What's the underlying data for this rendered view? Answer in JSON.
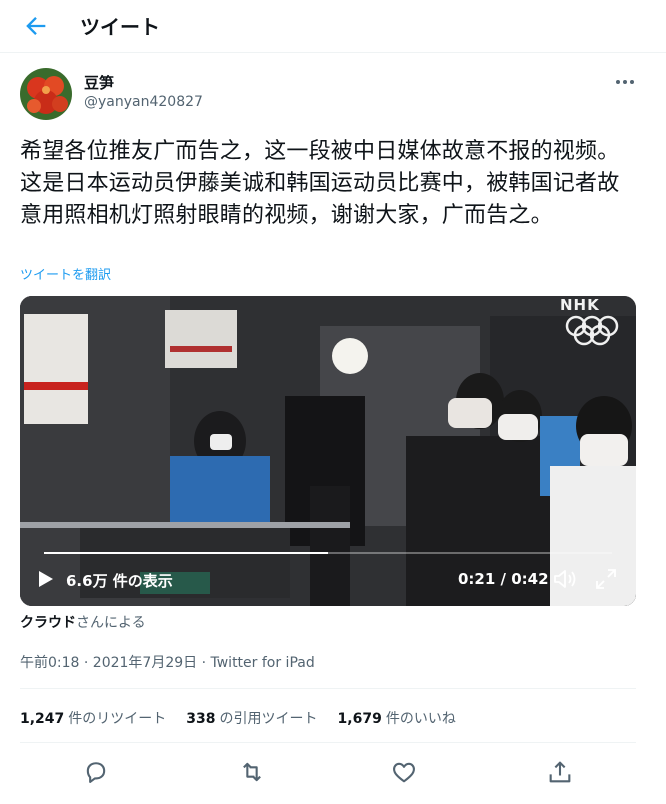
{
  "header": {
    "title": "ツイート"
  },
  "author": {
    "display_name": "豆笋",
    "handle": "@yanyan420827"
  },
  "tweet": {
    "text": "希望各位推友广而告之，这一段被中日媒体故意不报的视频。这是日本运动员伊藤美诚和韩国运动员比赛中，被韩国记者故意用照相机灯照射眼睛的视频，谢谢大家，广而告之。",
    "translate_label": "ツイートを翻訳"
  },
  "video": {
    "views_label": "6.6万 件の表示",
    "time_label": "0:21 / 0:42",
    "progress": 0.5,
    "watermark": "NHK"
  },
  "credit": {
    "name": "クラウド",
    "suffix": "さんによる"
  },
  "meta": {
    "timestamp": "午前0:18 · 2021年7月29日 · Twitter for iPad"
  },
  "stats": {
    "retweets_count": "1,247",
    "retweets_label": "件のリツイート",
    "quotes_count": "338",
    "quotes_label": "の引用ツイート",
    "likes_count": "1,679",
    "likes_label": "件のいいね"
  },
  "colors": {
    "accent": "#1d9bf0",
    "text": "#0f1419",
    "secondary": "#536471"
  },
  "icons": [
    "back-arrow-icon",
    "more-icon",
    "play-icon",
    "volume-icon",
    "fullscreen-icon",
    "reply-icon",
    "retweet-icon",
    "like-icon",
    "share-icon"
  ]
}
